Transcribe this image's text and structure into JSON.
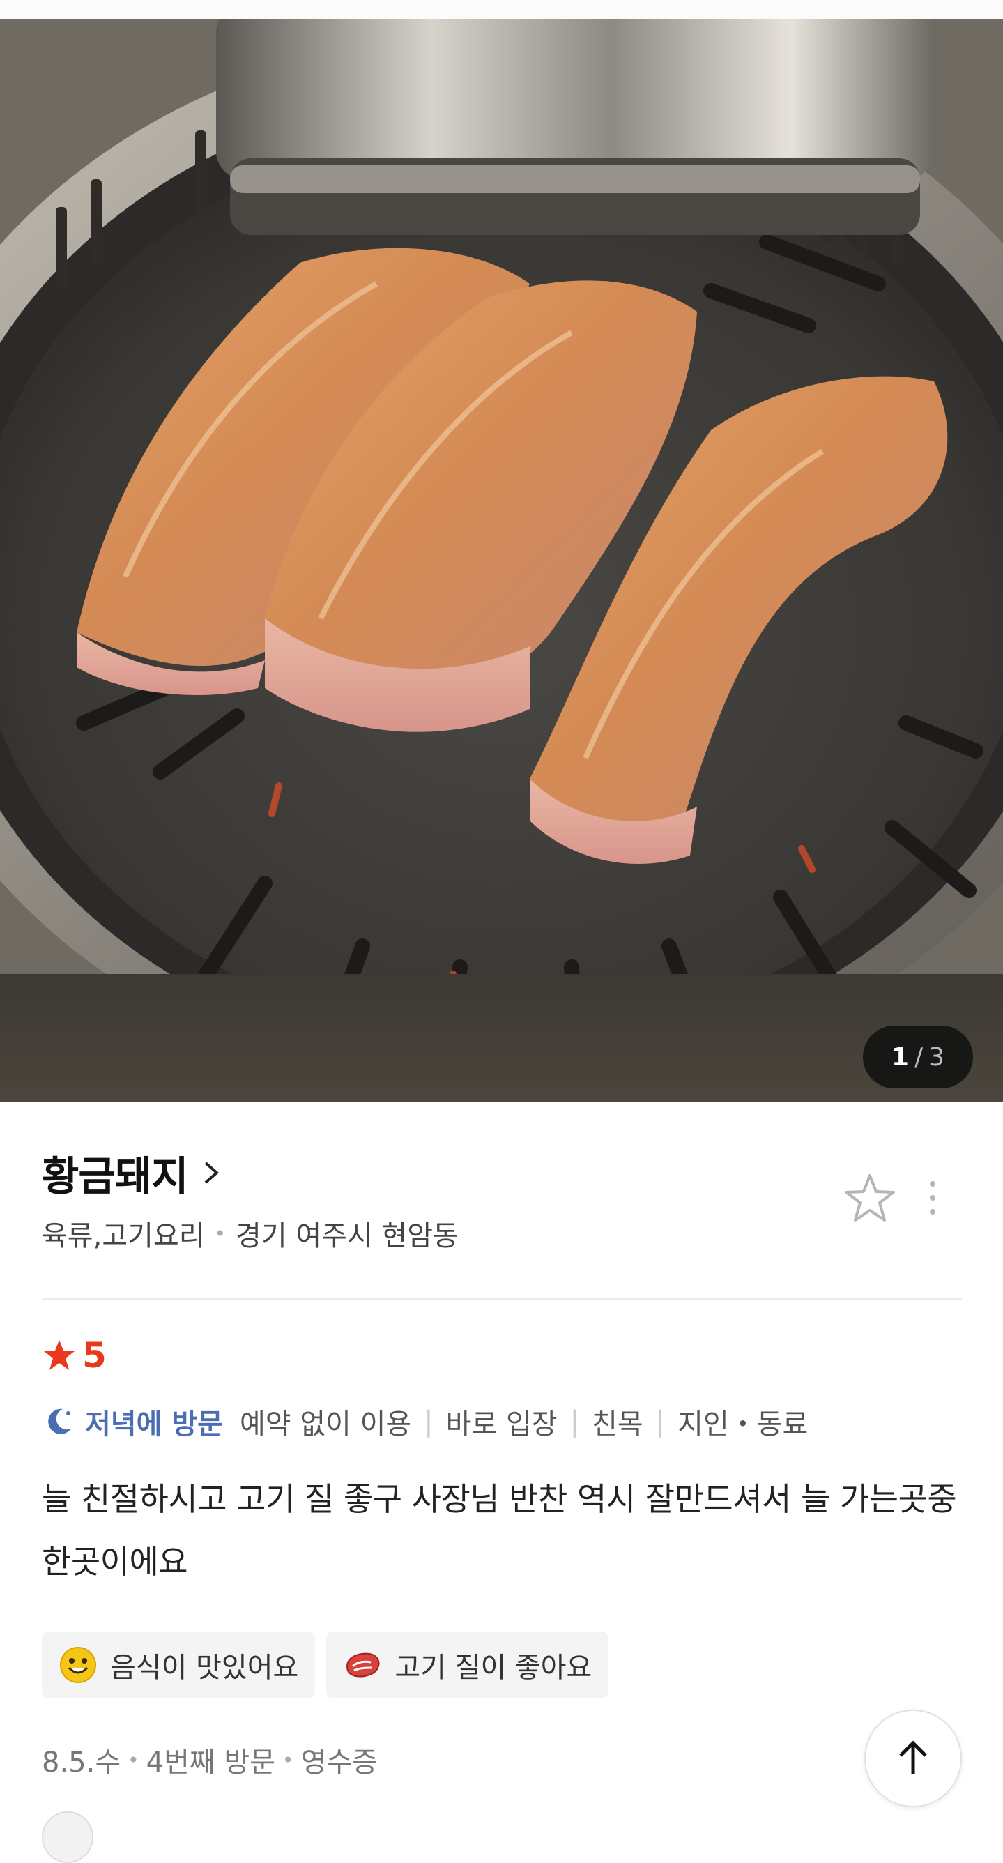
{
  "gallery": {
    "current": "1",
    "separator": "/",
    "total": "3"
  },
  "place": {
    "name": "황금돼지",
    "category": "육류,고기요리",
    "location": "경기 여주시 현암동"
  },
  "review": {
    "rating": "5",
    "visit_time": "저녁에 방문",
    "visit_tags": [
      "예약 없이 이용",
      "바로 입장",
      "친목",
      "지인・동료"
    ],
    "text": "늘 친절하시고 고기 질 좋구 사장님 반찬 역시 잘만드셔서 늘 가는곳중 한곳이에요",
    "keyword_tags": [
      {
        "icon": "smile-emoji-icon",
        "label": "음식이 맛있어요"
      },
      {
        "icon": "meat-steak-icon",
        "label": "고기 질이 좋아요"
      }
    ],
    "date": "8.5.수",
    "visit_count": "4번째 방문",
    "verification": "영수증"
  },
  "colors": {
    "rating_red": "#e8391d",
    "visit_blue": "#4a6db3"
  }
}
